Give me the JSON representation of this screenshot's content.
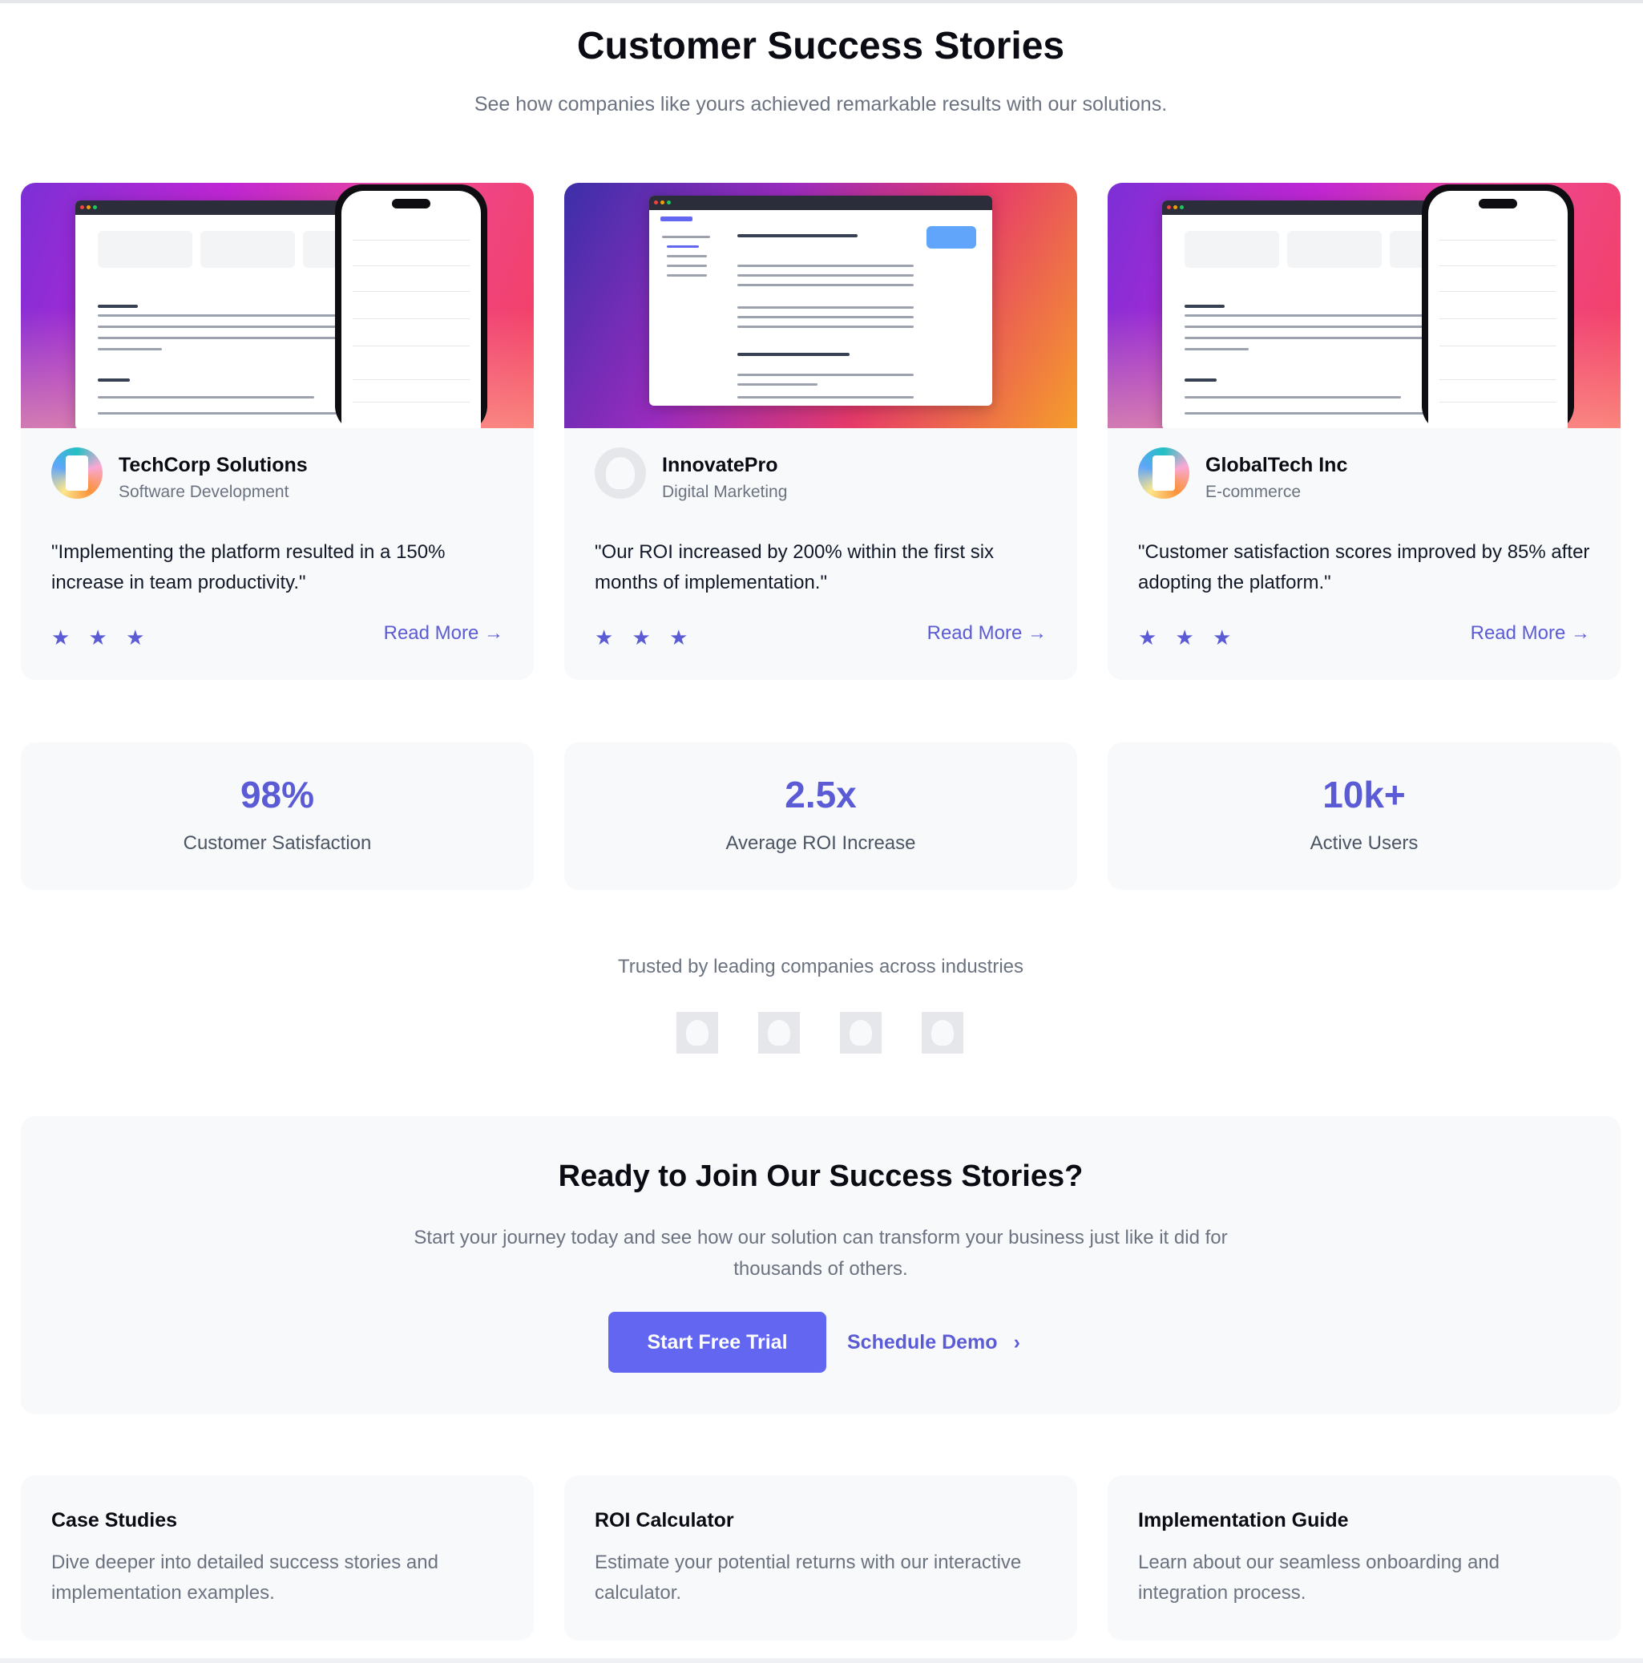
{
  "header": {
    "title": "Customer Success Stories",
    "subtitle": "See how companies like yours achieved remarkable results with our solutions."
  },
  "stories": [
    {
      "company": "TechCorp Solutions",
      "industry": "Software Development",
      "quote": "\"Implementing the platform resulted in a 150% increase in team productivity.\"",
      "stars": "★ ★ ★",
      "link": "Read More →"
    },
    {
      "company": "InnovatePro",
      "industry": "Digital Marketing",
      "quote": "\"Our ROI increased by 200% within the first six months of implementation.\"",
      "stars": "★ ★ ★",
      "link": "Read More →"
    },
    {
      "company": "GlobalTech Inc",
      "industry": "E-commerce",
      "quote": "\"Customer satisfaction scores improved by 85% after adopting the platform.\"",
      "stars": "★ ★ ★",
      "link": "Read More →"
    }
  ],
  "stats": [
    {
      "value": "98%",
      "label": "Customer Satisfaction"
    },
    {
      "value": "2.5x",
      "label": "Average ROI Increase"
    },
    {
      "value": "10k+",
      "label": "Active Users"
    }
  ],
  "trusted": "Trusted by leading companies across industries",
  "cta": {
    "title": "Ready to Join Our Success Stories?",
    "text": "Start your journey today and see how our solution can transform your business just like it did for thousands of others.",
    "primary": "Start Free Trial",
    "secondary": "Schedule Demo",
    "secondary_icon": "›"
  },
  "resources": [
    {
      "title": "Case Studies",
      "text": "Dive deeper into detailed success stories and implementation examples."
    },
    {
      "title": "ROI Calculator",
      "text": "Estimate your potential returns with our interactive calculator."
    },
    {
      "title": "Implementation Guide",
      "text": "Learn about our seamless onboarding and integration process."
    }
  ],
  "icons": {
    "star": "star-icon",
    "arrow": "arrow-right-icon",
    "chevron": "chevron-right-icon"
  },
  "colors": {
    "accent": "#5b5bd6",
    "button": "#6366f1",
    "card_bg": "#f8f9fb"
  }
}
